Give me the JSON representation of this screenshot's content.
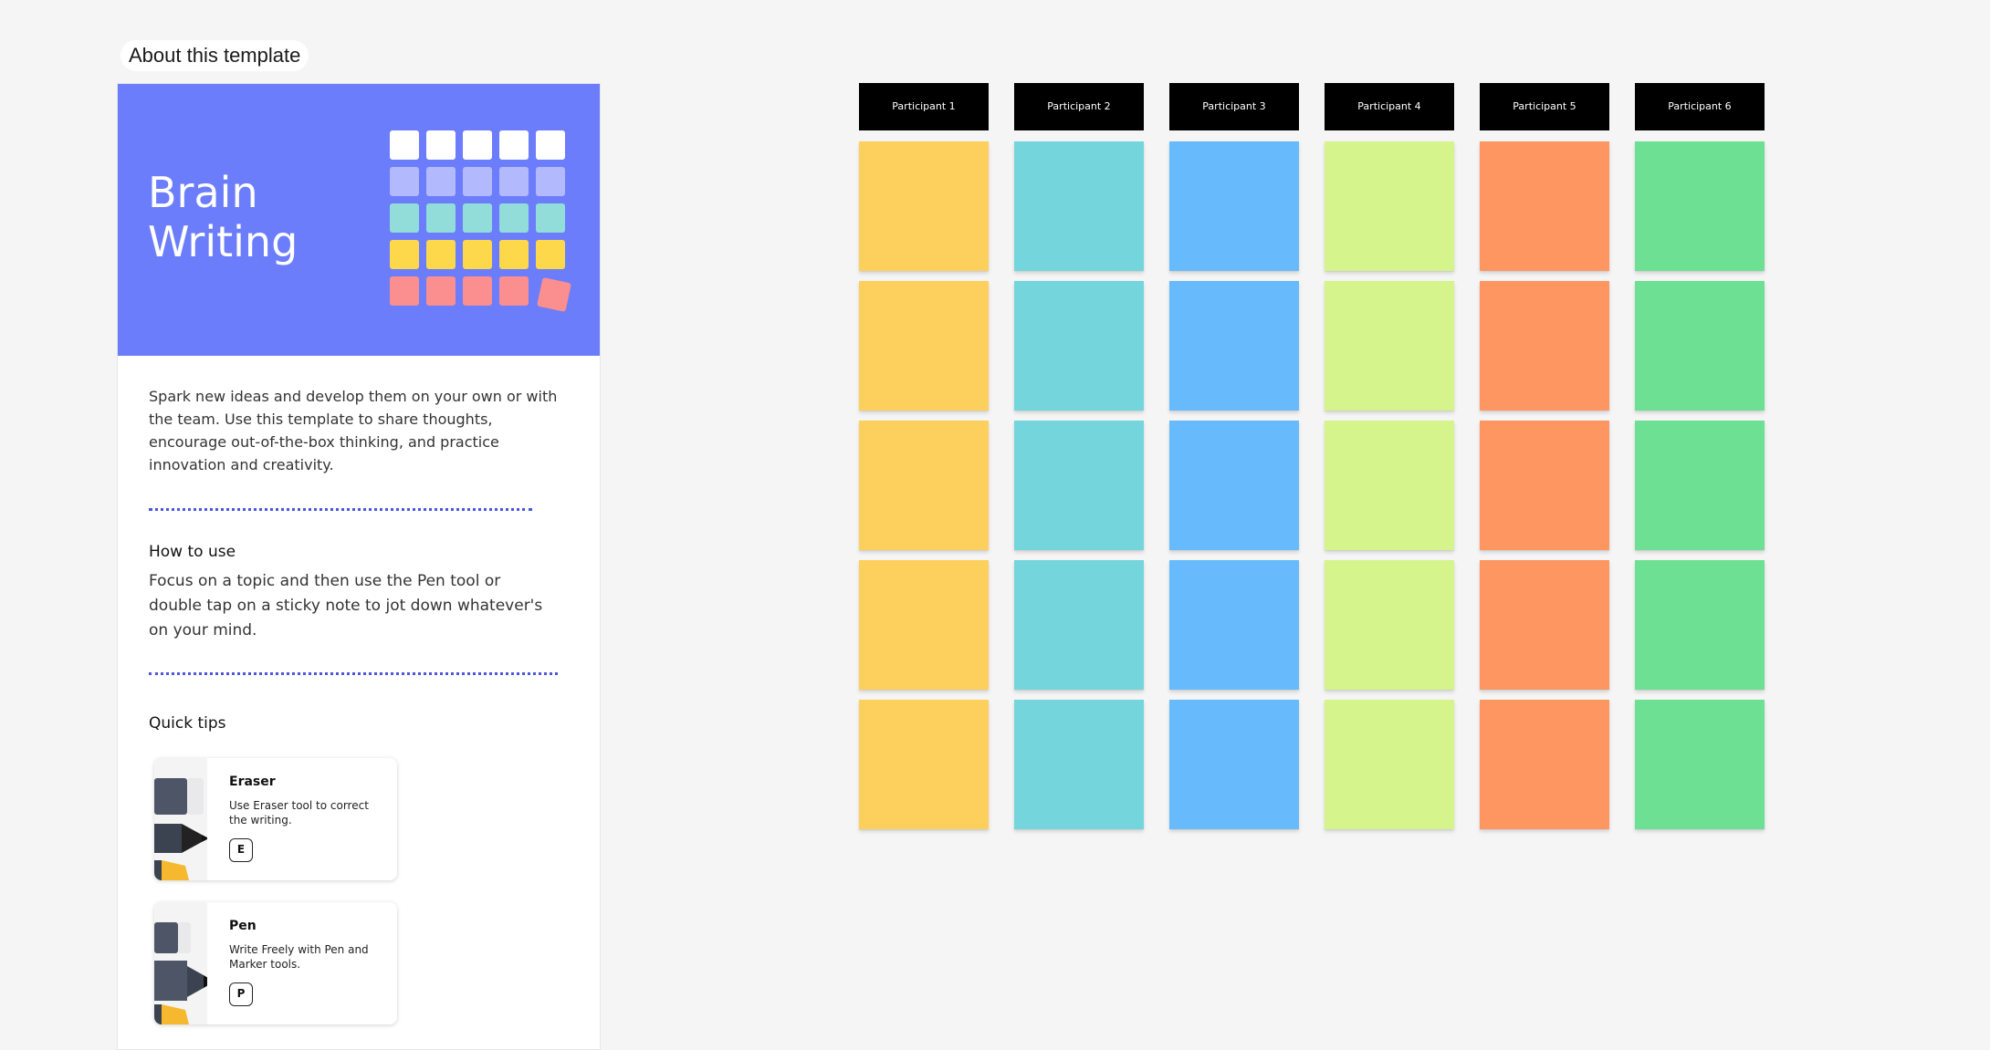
{
  "about_label": "About this template",
  "hero": {
    "title": "Brain Writing",
    "bg_color": "#6b7dfb",
    "grid_rows": [
      "#ffffff",
      "#b3b9fd",
      "#92ddd9",
      "#fdd84a",
      "#fb8e8e"
    ]
  },
  "description": "Spark new ideas and develop them on your own or with the team. Use this template to share thoughts, encourage out-of-the-box thinking, and practice innovation and creativity.",
  "how_to_use": {
    "title": "How to use",
    "body": "Focus on a topic and then use the Pen tool or double tap on a sticky note to jot down whatever's on your mind."
  },
  "quick_tips": {
    "title": "Quick tips",
    "tips": [
      {
        "title": "Eraser",
        "desc": "Use Eraser tool to correct the writing.",
        "key": "E",
        "icon": "eraser-icon"
      },
      {
        "title": "Pen",
        "desc": "Write Freely with Pen and Marker tools.",
        "key": "P",
        "icon": "pen-icon"
      }
    ]
  },
  "board": {
    "participants": [
      "Participant 1",
      "Participant 2",
      "Participant 3",
      "Participant 4",
      "Participant 5",
      "Participant 6"
    ],
    "colors": [
      "#fdd05e",
      "#74d6dc",
      "#67bbfd",
      "#d5f48c",
      "#fd9661",
      "#6ee093"
    ],
    "rows": 5
  }
}
